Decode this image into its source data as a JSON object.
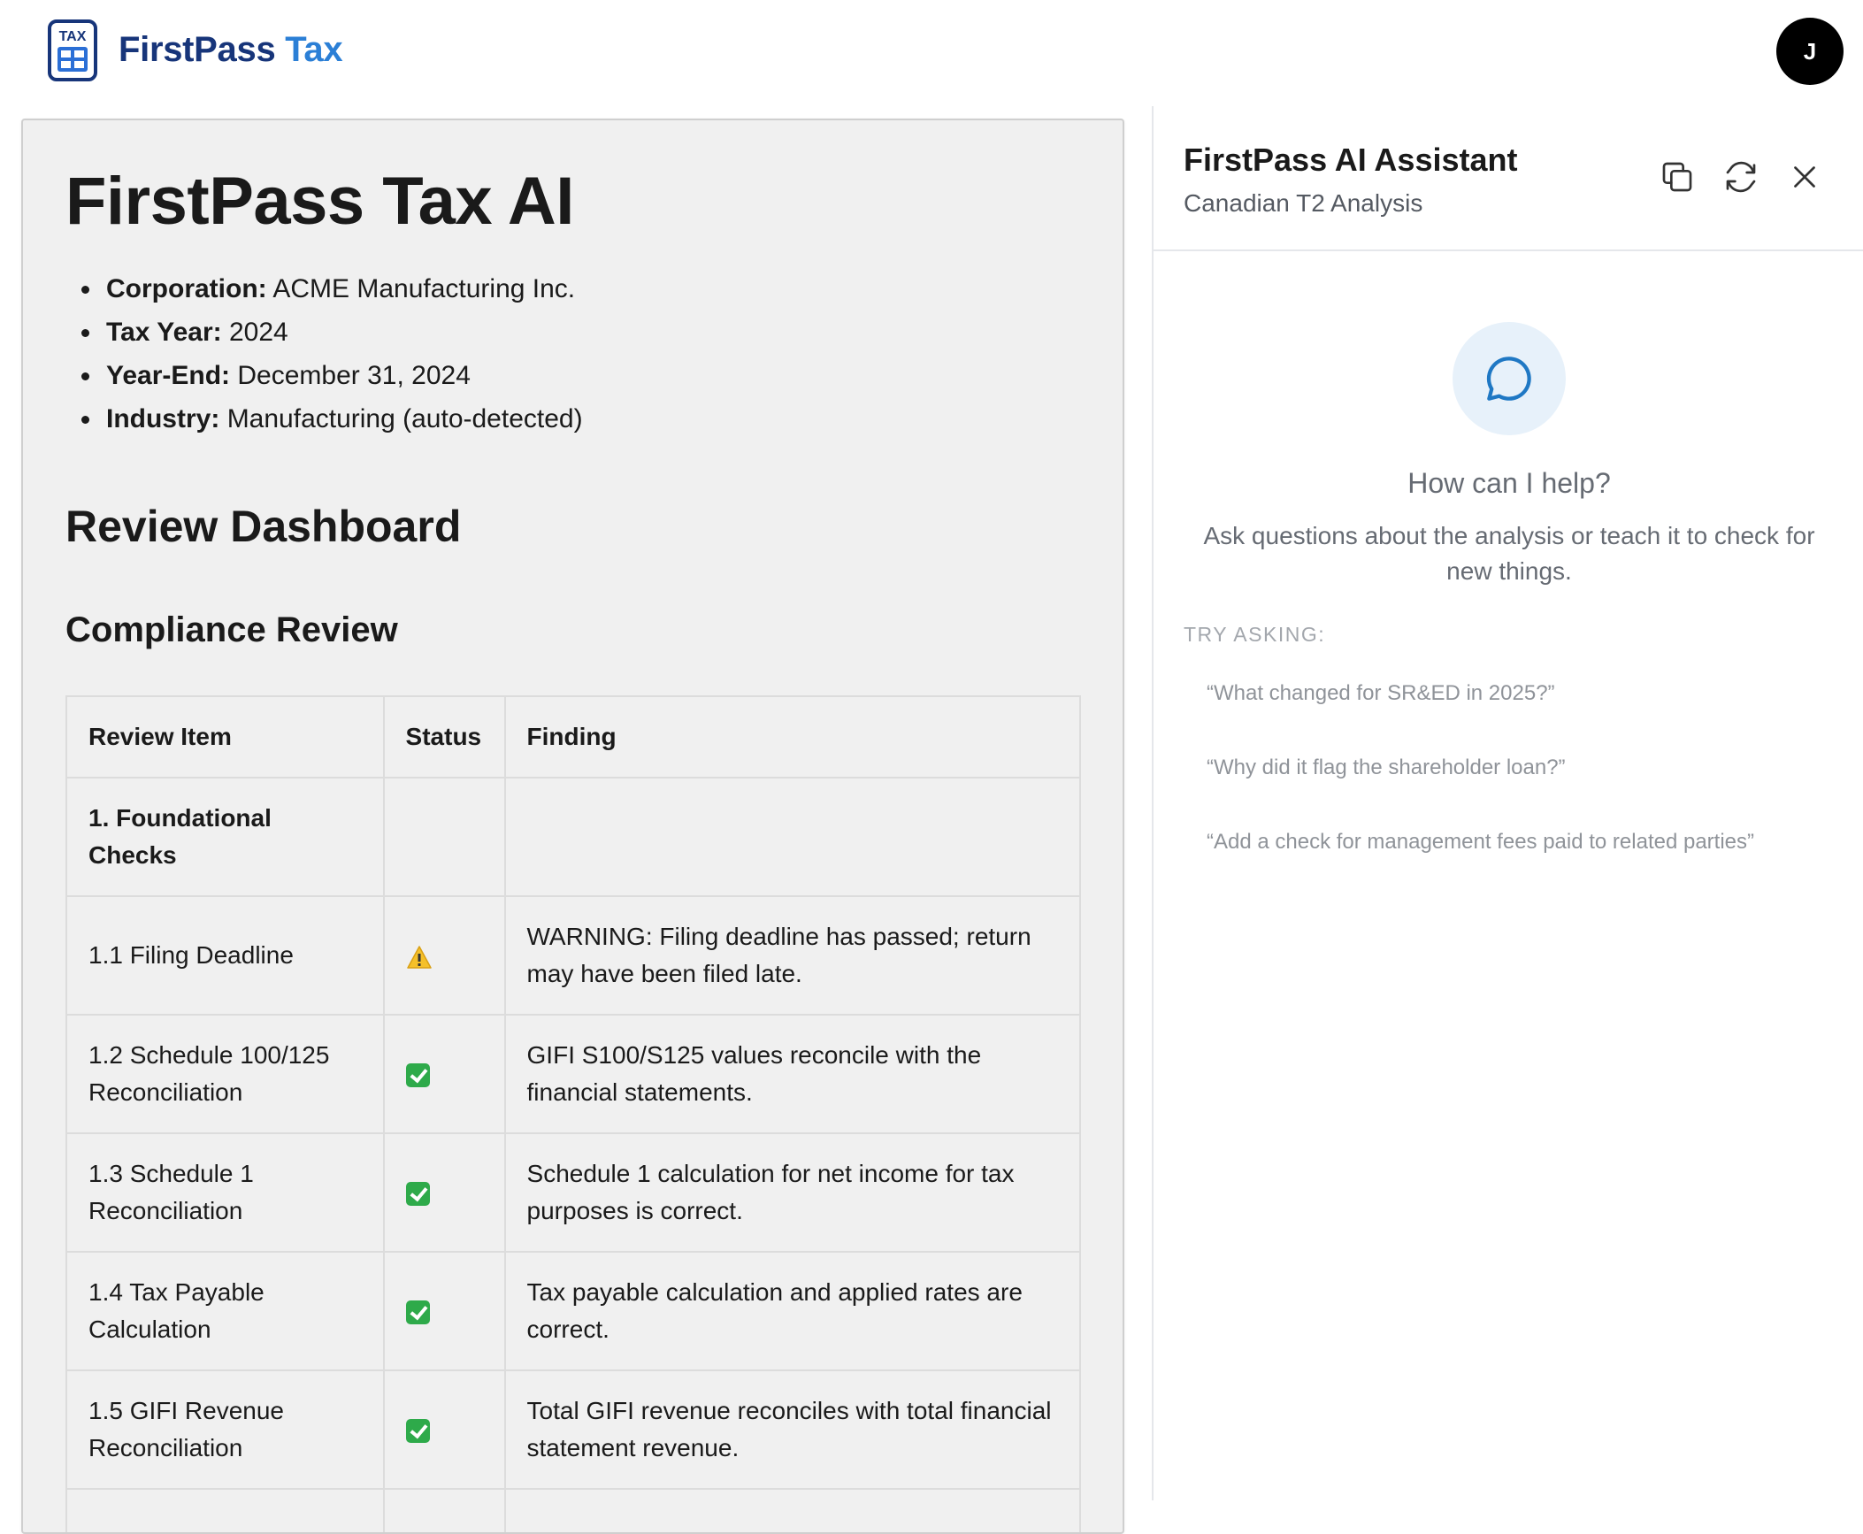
{
  "header": {
    "logo_text": "TAX",
    "brand_primary": "FirstPass",
    "brand_accent": "Tax",
    "avatar_initial": "J",
    "colors": {
      "brand_dark": "#17357a",
      "brand_light": "#2b7fd6"
    }
  },
  "document": {
    "title": "FirstPass Tax AI",
    "meta": [
      {
        "label": "Corporation:",
        "value": "ACME Manufacturing Inc."
      },
      {
        "label": "Tax Year:",
        "value": "2024"
      },
      {
        "label": "Year-End:",
        "value": "December 31, 2024"
      },
      {
        "label": "Industry:",
        "value": "Manufacturing (auto-detected)"
      }
    ],
    "dashboard_heading": "Review Dashboard",
    "section_heading": "Compliance Review",
    "table": {
      "headers": [
        "Review Item",
        "Status",
        "Finding"
      ],
      "section_row": "1. Foundational Checks",
      "rows": [
        {
          "item": "1.1 Filing Deadline",
          "status": "warning",
          "finding": "WARNING: Filing deadline has passed; return may have been filed late."
        },
        {
          "item": "1.2 Schedule 100/125 Reconciliation",
          "status": "pass",
          "finding": "GIFI S100/S125 values reconcile with the financial statements."
        },
        {
          "item": "1.3 Schedule 1 Reconciliation",
          "status": "pass",
          "finding": "Schedule 1 calculation for net income for tax purposes is correct."
        },
        {
          "item": "1.4 Tax Payable Calculation",
          "status": "pass",
          "finding": "Tax payable calculation and applied rates are correct."
        },
        {
          "item": "1.5 GIFI Revenue Reconciliation",
          "status": "pass",
          "finding": "Total GIFI revenue reconciles with total financial statement revenue."
        }
      ]
    }
  },
  "assistant": {
    "title": "FirstPass AI Assistant",
    "subtitle": "Canadian T2 Analysis",
    "empty_title": "How can I help?",
    "empty_desc": "Ask questions about the analysis or teach it to check for new things.",
    "try_label": "TRY ASKING:",
    "suggestions": [
      "“What changed for SR&ED in 2025?”",
      "“Why did it flag the shareholder loan?”",
      "“Add a check for management fees paid to related parties”"
    ],
    "icons": [
      "copy-icon",
      "refresh-icon",
      "close-icon",
      "chat-bubble-icon"
    ]
  }
}
